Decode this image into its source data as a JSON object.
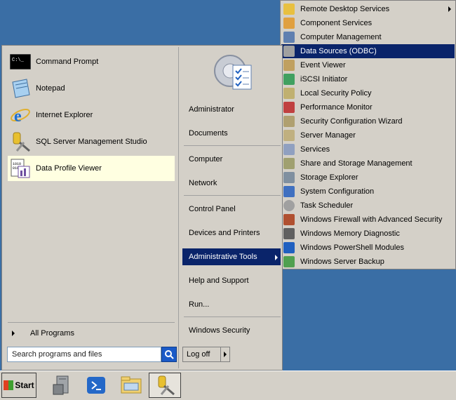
{
  "start_menu": {
    "programs": [
      {
        "label": "Command Prompt",
        "icon": "command-prompt-icon"
      },
      {
        "label": "Notepad",
        "icon": "notepad-icon"
      },
      {
        "label": "Internet Explorer",
        "icon": "internet-explorer-icon"
      },
      {
        "label": "SQL Server Management Studio",
        "icon": "sql-server-icon"
      },
      {
        "label": "Data Profile Viewer",
        "icon": "data-profile-viewer-icon"
      }
    ],
    "all_programs": "All Programs",
    "search_placeholder": "Search programs and files",
    "right_items": {
      "administrator": "Administrator",
      "documents": "Documents",
      "computer": "Computer",
      "network": "Network",
      "control_panel": "Control Panel",
      "devices_printers": "Devices and Printers",
      "admin_tools": "Administrative Tools",
      "help_support": "Help and Support",
      "run": "Run...",
      "windows_security": "Windows Security"
    },
    "log_off": "Log off"
  },
  "admin_tools_menu": {
    "items": [
      {
        "label": "Remote Desktop Services",
        "color": "#e8c040"
      },
      {
        "label": "Component Services",
        "color": "#e0a040"
      },
      {
        "label": "Computer Management",
        "color": "#6080b0"
      },
      {
        "label": "Data Sources (ODBC)",
        "color": "#a0a0a0"
      },
      {
        "label": "Event Viewer",
        "color": "#c0a060"
      },
      {
        "label": "iSCSI Initiator",
        "color": "#40a060"
      },
      {
        "label": "Local Security Policy",
        "color": "#c0b070"
      },
      {
        "label": "Performance Monitor",
        "color": "#c04040"
      },
      {
        "label": "Security Configuration Wizard",
        "color": "#b0a070"
      },
      {
        "label": "Server Manager",
        "color": "#c0b080"
      },
      {
        "label": "Services",
        "color": "#90a0c0"
      },
      {
        "label": "Share and Storage Management",
        "color": "#a0a070"
      },
      {
        "label": "Storage Explorer",
        "color": "#8090a0"
      },
      {
        "label": "System Configuration",
        "color": "#4070c0"
      },
      {
        "label": "Task Scheduler",
        "color": "#a0a0a0"
      },
      {
        "label": "Windows Firewall with Advanced Security",
        "color": "#b05030"
      },
      {
        "label": "Windows Memory Diagnostic",
        "color": "#606060"
      },
      {
        "label": "Windows PowerShell Modules",
        "color": "#2060c0"
      },
      {
        "label": "Windows Server Backup",
        "color": "#50a050"
      }
    ]
  },
  "taskbar": {
    "start_label": "Start",
    "buttons": [
      "server-manager-icon",
      "powershell-icon",
      "explorer-icon",
      "sql-server-icon"
    ]
  }
}
